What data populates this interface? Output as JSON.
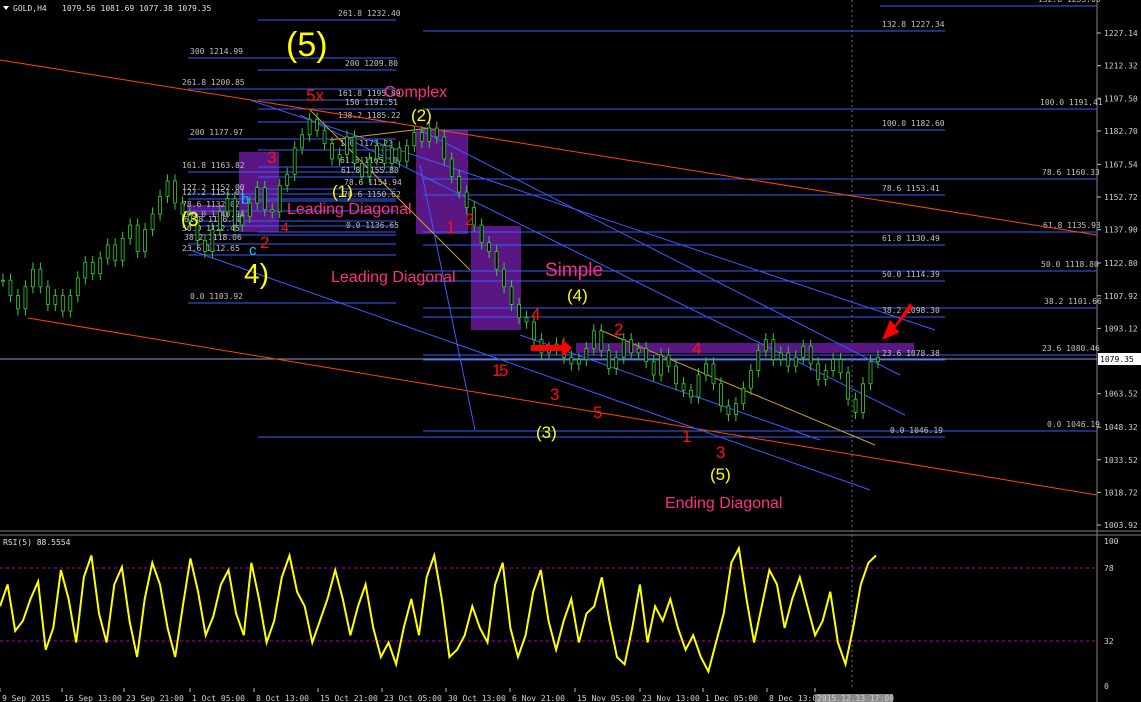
{
  "header": {
    "symbol_text": "GOLD,H4",
    "ohlc_text": "1079.56 1081.69 1077.38 1079.35"
  },
  "rsi": {
    "title": "RSI(5) 88.5554",
    "levels": [
      "100",
      "78",
      "32",
      "0"
    ]
  },
  "colors": {
    "background": "#000000",
    "candles": "#32cd32",
    "rsi_line": "#ffff00",
    "fib_lines": "#4a6cff",
    "channel_lines": "#ff4500",
    "boxes": "#6a1b9a",
    "wave_red": "#ff1010",
    "wave_yellow": "#ffff00",
    "text_pink": "#ff2d8a"
  },
  "chart_data": {
    "type": "candlestick",
    "price_axis_ticks": [
      "1227.14",
      "1212.32",
      "1197.50",
      "1182.70",
      "1167.54",
      "1152.72",
      "1137.90",
      "1122.80",
      "1107.92",
      "1093.12",
      "1079.35",
      "1063.52",
      "1048.32",
      "1033.52",
      "1018.72",
      "1003.92"
    ],
    "current_price": "1079.35",
    "time_axis_ticks": [
      "9 Sep 2015",
      "16 Sep 13:00",
      "23 Sep 21:00",
      "1 Oct 05:00",
      "8 Oct 13:00",
      "15 Oct 21:00",
      "23 Oct 05:00",
      "30 Oct 13:00",
      "6 Nov 21:00",
      "15 Nov 05:00",
      "23 Nov 13:00",
      "1 Dec 05:00",
      "8 Dec 13:00",
      "2015.12.13 17:00"
    ],
    "price_series": [
      1115,
      1108,
      1102,
      1112,
      1120,
      1112,
      1104,
      1108,
      1101,
      1108,
      1116,
      1123,
      1118,
      1125,
      1131,
      1124,
      1134,
      1140,
      1128,
      1138,
      1145,
      1153,
      1160,
      1150,
      1145,
      1142,
      1133,
      1128,
      1138,
      1146,
      1152,
      1140,
      1144,
      1150,
      1157,
      1147,
      1146,
      1158,
      1163,
      1175,
      1181,
      1188,
      1183,
      1177,
      1170,
      1172,
      1180,
      1168,
      1162,
      1170,
      1176,
      1168,
      1175,
      1169,
      1176,
      1182,
      1178,
      1184,
      1180,
      1170,
      1162,
      1155,
      1148,
      1140,
      1132,
      1128,
      1120,
      1112,
      1104,
      1098,
      1096,
      1088,
      1082,
      1084,
      1086,
      1080,
      1077,
      1079,
      1084,
      1092,
      1083,
      1075,
      1080,
      1088,
      1082,
      1084,
      1078,
      1072,
      1081,
      1076,
      1068,
      1065,
      1062,
      1072,
      1077,
      1068,
      1058,
      1054,
      1059,
      1066,
      1074,
      1083,
      1088,
      1079,
      1082,
      1076,
      1080,
      1085,
      1077,
      1070,
      1074,
      1079,
      1073,
      1061,
      1055,
      1068,
      1078,
      1080
    ],
    "rsi_series": [
      55,
      70,
      38,
      45,
      60,
      72,
      25,
      40,
      80,
      60,
      30,
      75,
      90,
      50,
      30,
      70,
      82,
      45,
      20,
      60,
      85,
      70,
      40,
      20,
      55,
      88,
      65,
      35,
      48,
      70,
      80,
      50,
      35,
      85,
      60,
      30,
      45,
      75,
      90,
      65,
      55,
      30,
      45,
      60,
      80,
      60,
      35,
      55,
      70,
      40,
      20,
      30,
      15,
      40,
      60,
      35,
      75,
      90,
      60,
      20,
      25,
      35,
      55,
      40,
      30,
      70,
      85,
      40,
      20,
      35,
      65,
      80,
      45,
      25,
      45,
      60,
      30,
      50,
      55,
      75,
      45,
      20,
      15,
      40,
      70,
      30,
      55,
      45,
      60,
      40,
      25,
      35,
      20,
      10,
      30,
      50,
      85,
      95,
      60,
      30,
      55,
      80,
      70,
      40,
      60,
      75,
      55,
      35,
      45,
      65,
      30,
      15,
      40,
      70,
      85,
      90
    ],
    "fib_levels": [
      {
        "label": "261.8 1232.40"
      },
      {
        "label": "200 1209.80"
      },
      {
        "label": "300 1214.99"
      },
      {
        "label": "261.8 1200.85"
      },
      {
        "label": "161.8 1195.89"
      },
      {
        "label": "150 1191.51"
      },
      {
        "label": "138.2 1185.22"
      },
      {
        "label": "200 1177.97"
      },
      {
        "label": "100 1173.23"
      },
      {
        "label": "161.8 1163.82"
      },
      {
        "label": "61.8 1165.10"
      },
      {
        "label": "61.8 1155.80"
      },
      {
        "label": "127.2 1152.00"
      },
      {
        "label": "127.2 1151.01"
      },
      {
        "label": "78.6 1154.94"
      },
      {
        "label": "78.6 1150.62"
      },
      {
        "label": "100.0 1140.94"
      },
      {
        "label": "78.6 1132.02"
      },
      {
        "label": "0.0 1136.65"
      },
      {
        "label": "61.8 1126.80"
      },
      {
        "label": "50.0 1122.45"
      },
      {
        "label": "38.2 1118.06"
      },
      {
        "label": "23.6 1112.65"
      },
      {
        "label": "0.0 1103.92"
      },
      {
        "label": "132.8 1227.34"
      },
      {
        "label": "100.0 1191.41"
      },
      {
        "label": "100.0 1182.60"
      },
      {
        "label": "78.6 1160.33"
      },
      {
        "label": "78.6 1153.41"
      },
      {
        "label": "61.8 1135.93"
      },
      {
        "label": "61.8 1130.49"
      },
      {
        "label": "50.0 1118.80"
      },
      {
        "label": "50.0 1114.39"
      },
      {
        "label": "38.2 1101.66"
      },
      {
        "label": "38.2 1098.30"
      },
      {
        "label": "23.6 1080.46"
      },
      {
        "label": "23.6 1078.38"
      },
      {
        "label": "0.0 1046.19"
      },
      {
        "label": "0.0 1046.19"
      },
      {
        "label": "132.8 1233.00"
      }
    ],
    "wave_labels_red": [
      "5x",
      "3",
      "2",
      "4",
      "1",
      "2",
      "1",
      "4",
      "3",
      "5",
      "2",
      "4",
      "1",
      "3",
      "5"
    ],
    "wave_labels_yellow": [
      "(5)",
      "(2)",
      "(1)",
      "4)",
      "(4)",
      "(3)",
      "(5)",
      "(3"
    ],
    "wave_labels_cyan": [
      "b",
      "c"
    ],
    "annotations": [
      "Complex",
      "Leading Diagonal",
      "Leading Diagonal",
      "Simple",
      "Ending Diagonal"
    ]
  }
}
